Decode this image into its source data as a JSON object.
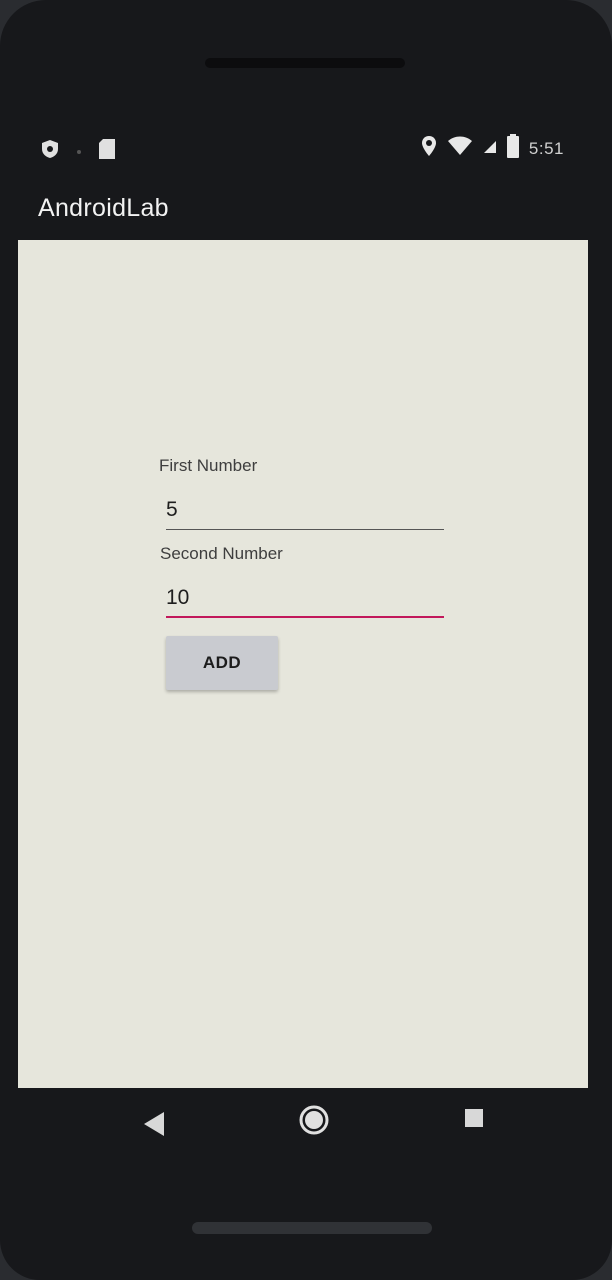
{
  "status_bar": {
    "time": "5:51",
    "left_icons": [
      "shield-icon",
      "notification-dot-icon",
      "sd-card-icon"
    ],
    "right_icons": [
      "location-icon",
      "wifi-icon",
      "signal-icon",
      "battery-icon"
    ]
  },
  "app_bar": {
    "title": "AndroidLab"
  },
  "form": {
    "first_number": {
      "label": "First Number",
      "value": "5"
    },
    "second_number": {
      "label": "Second Number",
      "value": "10"
    },
    "add_button_label": "ADD"
  },
  "nav_bar": {
    "buttons": [
      "back-icon",
      "home-icon",
      "recents-icon"
    ]
  },
  "colors": {
    "app_bar_bg": "#17181b",
    "content_bg": "#e6e6dc",
    "focused_underline": "#c2185b",
    "unfocused_underline": "#555555",
    "button_bg": "#c9cbd0"
  }
}
